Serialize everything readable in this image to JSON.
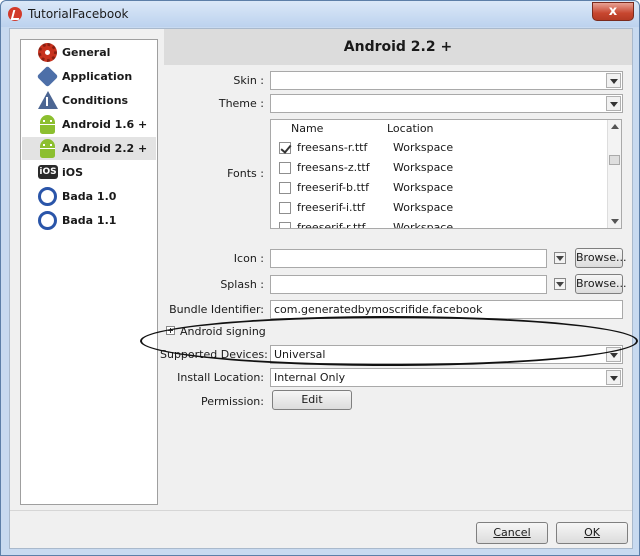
{
  "window": {
    "title": "TutorialFacebook",
    "close_symbol": "x"
  },
  "sidebar": {
    "items": [
      {
        "label": "General",
        "icon": "gear-icon"
      },
      {
        "label": "Application",
        "icon": "puzzle-icon"
      },
      {
        "label": "Conditions",
        "icon": "warning-icon"
      },
      {
        "label": "Android 1.6 +",
        "icon": "android-icon"
      },
      {
        "label": "Android 2.2 +",
        "icon": "android-icon",
        "selected": true
      },
      {
        "label": "iOS",
        "icon": "ios-icon",
        "badge": "iOS"
      },
      {
        "label": "Bada 1.0",
        "icon": "bada-icon"
      },
      {
        "label": "Bada 1.1",
        "icon": "bada-icon"
      }
    ]
  },
  "panel": {
    "title": "Android 2.2 +",
    "skin_label": "Skin :",
    "skin_value": "",
    "theme_label": "Theme :",
    "theme_value": "",
    "fonts_label": "Fonts :",
    "fonts": {
      "columns": [
        "Name",
        "Location"
      ],
      "rows": [
        {
          "name": "freesans-r.ttf",
          "location": "Workspace",
          "checked": true
        },
        {
          "name": "freesans-z.ttf",
          "location": "Workspace",
          "checked": false
        },
        {
          "name": "freeserif-b.ttf",
          "location": "Workspace",
          "checked": false
        },
        {
          "name": "freeserif-i.ttf",
          "location": "Workspace",
          "checked": false
        },
        {
          "name": "freeserif-r.ttf",
          "location": "Workspace",
          "checked": false
        }
      ]
    },
    "icon_label": "Icon :",
    "icon_value": "",
    "splash_label": "Splash :",
    "splash_value": "",
    "browse_label": "Browse...",
    "bundle_label": "Bundle Identifier:",
    "bundle_value": "com.generatedbymoscrifide.facebook",
    "signing_label": "Android signing",
    "devices_label": "Supported Devices:",
    "devices_value": "Universal",
    "install_label": "Install Location:",
    "install_value": "Internal Only",
    "permission_label": "Permission:",
    "edit_label": "Edit"
  },
  "footer": {
    "cancel_label": "Cancel",
    "ok_label": "OK"
  },
  "colors": {
    "title_bar": "#c8daf0",
    "close_button": "#c7462f",
    "heading_bg": "#dcdcdc",
    "selected_item": "#e3e3e3"
  }
}
